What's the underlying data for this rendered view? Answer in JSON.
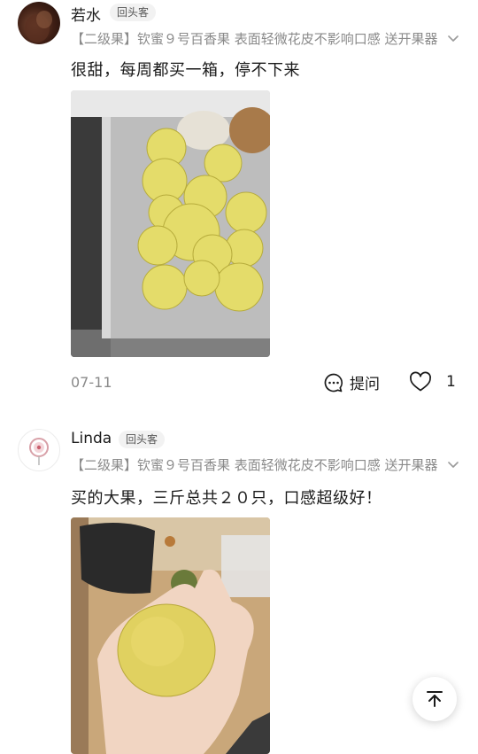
{
  "reviews": [
    {
      "name": "若水",
      "badge": "回头客",
      "spec": "【二级果】钦蜜９号百香果 表面轻微花皮不影响口感 送开果器",
      "text": "很甜，每周都买一箱，停不下来",
      "date": "07-11",
      "ask_label": "提问",
      "like_count": "1"
    },
    {
      "name": "Linda",
      "badge": "回头客",
      "spec": "【二级果】钦蜜９号百香果 表面轻微花皮不影响口感 送开果器",
      "text": "买的大果，三斤总共２０只，口感超级好！"
    }
  ],
  "icons": {
    "expand": "chevron-down-icon",
    "ask": "question-bubble-icon",
    "like": "heart-icon",
    "back_to_top": "arrow-up-to-top-icon"
  },
  "colors": {
    "text": "#1a1a1a",
    "muted": "#8a8a8a",
    "badge_bg": "#f2f2f2"
  }
}
